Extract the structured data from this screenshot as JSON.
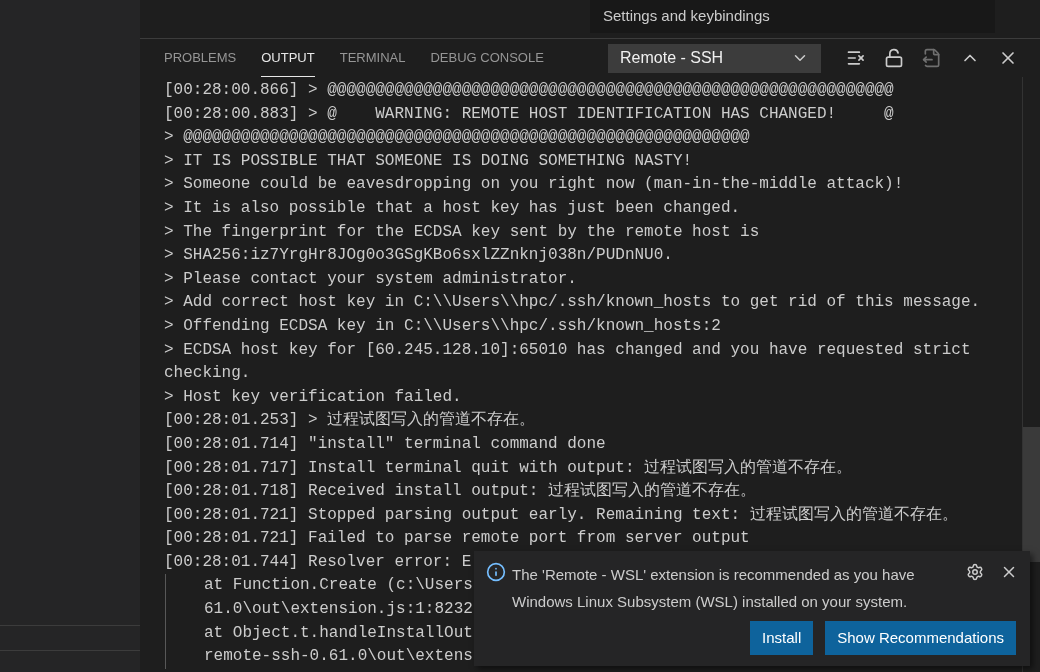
{
  "tooltip": "Settings and keybindings",
  "panel": {
    "tabs": [
      {
        "label": "PROBLEMS",
        "selected": false
      },
      {
        "label": "OUTPUT",
        "selected": true
      },
      {
        "label": "TERMINAL",
        "selected": false
      },
      {
        "label": "DEBUG CONSOLE",
        "selected": false
      }
    ],
    "channel_select": {
      "value": "Remote - SSH"
    }
  },
  "output": {
    "lines": [
      {
        "kind": "log",
        "text": "[00:28:00.866] > @@@@@@@@@@@@@@@@@@@@@@@@@@@@@@@@@@@@@@@@@@@@@@@@@@@@@@@@@@@"
      },
      {
        "kind": "log",
        "text": "[00:28:00.883] > @    WARNING: REMOTE HOST IDENTIFICATION HAS CHANGED!     @"
      },
      {
        "kind": "log",
        "text": "> @@@@@@@@@@@@@@@@@@@@@@@@@@@@@@@@@@@@@@@@@@@@@@@@@@@@@@@@@@@"
      },
      {
        "kind": "log",
        "text": "> IT IS POSSIBLE THAT SOMEONE IS DOING SOMETHING NASTY!"
      },
      {
        "kind": "log",
        "text": "> Someone could be eavesdropping on you right now (man-in-the-middle attack)!"
      },
      {
        "kind": "log",
        "text": "> It is also possible that a host key has just been changed."
      },
      {
        "kind": "log",
        "text": "> The fingerprint for the ECDSA key sent by the remote host is"
      },
      {
        "kind": "log",
        "text": "> SHA256:iz7YrgHr8JOg0o3GSgKBo6sxlZZnknj038n/PUDnNU0."
      },
      {
        "kind": "log",
        "text": "> Please contact your system administrator."
      },
      {
        "kind": "log",
        "text": "> Add correct host key in C:\\\\Users\\\\hpc/.ssh/known_hosts to get rid of this message."
      },
      {
        "kind": "log",
        "text": "> Offending ECDSA key in C:\\\\Users\\\\hpc/.ssh/known_hosts:2"
      },
      {
        "kind": "log",
        "text": "> ECDSA host key for [60.245.128.10]:65010 has changed and you have requested strict checking."
      },
      {
        "kind": "log",
        "text": "> Host key verification failed."
      },
      {
        "kind": "log",
        "text": "[00:28:01.253] > 过程试图写入的管道不存在。"
      },
      {
        "kind": "log",
        "text": "[00:28:01.714] \"install\" terminal command done"
      },
      {
        "kind": "log",
        "text": "[00:28:01.717] Install terminal quit with output: 过程试图写入的管道不存在。"
      },
      {
        "kind": "log",
        "text": "[00:28:01.718] Received install output: 过程试图写入的管道不存在。"
      },
      {
        "kind": "log",
        "text": "[00:28:01.721] Stopped parsing output early. Remaining text: 过程试图写入的管道不存在。"
      },
      {
        "kind": "log",
        "text": "[00:28:01.721] Failed to parse remote port from server output"
      },
      {
        "kind": "log",
        "text": "[00:28:01.744] Resolver error: E"
      },
      {
        "kind": "stack",
        "text": "at Function.Create (c:\\Users"
      },
      {
        "kind": "stack",
        "text": "61.0\\out\\extension.js:1:8232"
      },
      {
        "kind": "stack",
        "text": "at Object.t.handleInstallOut"
      },
      {
        "kind": "stack",
        "text": "remote-ssh-0.61.0\\out\\extens"
      }
    ]
  },
  "notification": {
    "message": "The 'Remote - WSL' extension is recommended as you have Windows Linux Subsystem (WSL) installed on your system.",
    "buttons": [
      "Install",
      "Show Recommendations"
    ]
  }
}
